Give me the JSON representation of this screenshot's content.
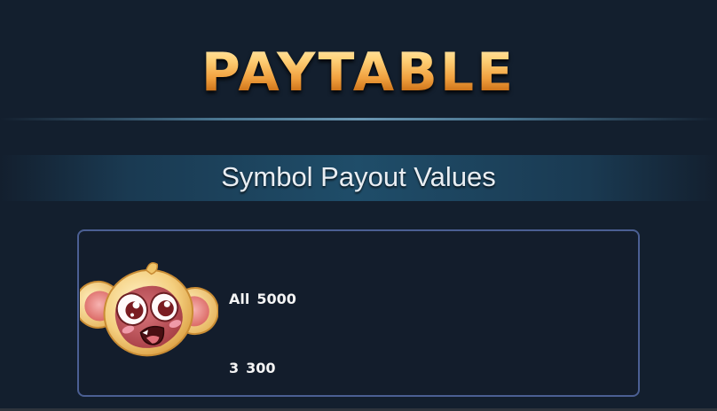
{
  "header": {
    "title": "PAYTABLE"
  },
  "section": {
    "title": "Symbol Payout Values"
  },
  "paytable": {
    "symbols": [
      {
        "icon": "monkey-head-icon",
        "payouts": [
          {
            "count": "All",
            "value": "5000"
          },
          {
            "count": "3",
            "value": "300"
          }
        ]
      }
    ]
  },
  "colors": {
    "background": "#131f2e",
    "title_gold": "#f1a13f",
    "card_border": "#4b5f93",
    "band_center": "#1f4d69"
  }
}
